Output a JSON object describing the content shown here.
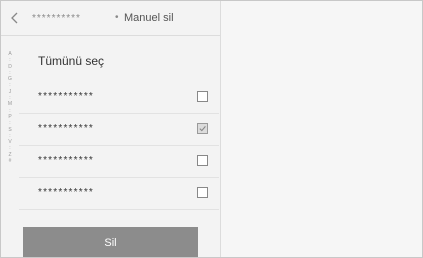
{
  "header": {
    "back_icon": "chevron-left-icon",
    "contact_name": "**********",
    "separator": "•",
    "title": "Manuel sil"
  },
  "index_letters": [
    "A",
    ":",
    "D",
    ":",
    "G",
    ":",
    "J",
    ":",
    "M",
    ":",
    "P",
    ":",
    "S",
    ":",
    "V",
    ":",
    "Z",
    "#"
  ],
  "select_all_label": "Tümünü seç",
  "contacts": [
    {
      "name": "***********",
      "checked": false
    },
    {
      "name": "***********",
      "checked": true
    },
    {
      "name": "***********",
      "checked": false
    },
    {
      "name": "***********",
      "checked": false
    }
  ],
  "delete_label": "Sil",
  "colors": {
    "panel": "#f3f3f3",
    "button": "#8c8c8c",
    "text": "#333333"
  }
}
